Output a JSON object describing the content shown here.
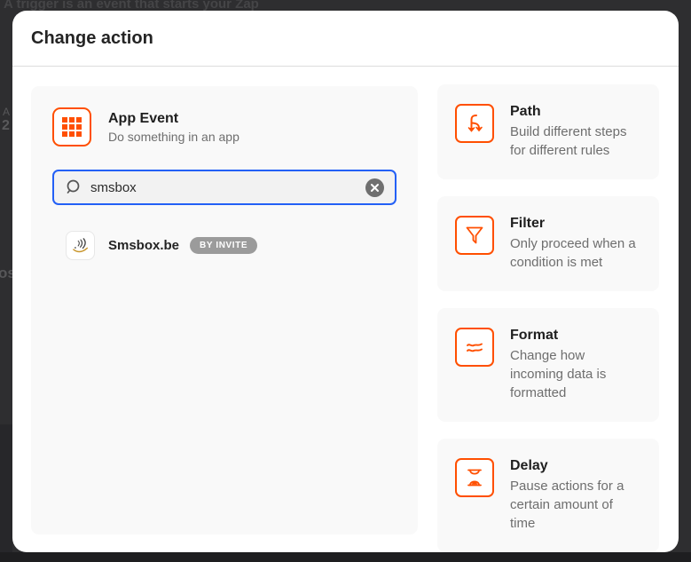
{
  "background": {
    "top_text": "A trigger is an event that starts your Zap",
    "left_fragment_a": "A",
    "left_fragment_2": "2",
    "left_fragment_ose": "ose"
  },
  "modal": {
    "title": "Change action",
    "left_panel": {
      "app_event": {
        "title": "App Event",
        "subtitle": "Do something in an app"
      },
      "search": {
        "value": "smsbox",
        "icon": "search-icon",
        "clear_icon": "clear-circle-icon"
      },
      "result": {
        "name": "Smsbox.be",
        "badge": "BY INVITE",
        "logo": "smsbox-logo"
      }
    },
    "cards": [
      {
        "icon": "path-icon",
        "title": "Path",
        "description": "Build different steps for different rules"
      },
      {
        "icon": "filter-icon",
        "title": "Filter",
        "description": "Only proceed when a condition is met"
      },
      {
        "icon": "format-icon",
        "title": "Format",
        "description": "Change how incoming data is formatted"
      },
      {
        "icon": "delay-icon",
        "title": "Delay",
        "description": "Pause actions for a certain amount of time"
      }
    ],
    "colors": {
      "accent_orange": "#FF4F00",
      "focus_blue": "#2360F6",
      "badge_gray": "#9B9B9B",
      "panel_gray": "#F9F9F9",
      "overlay_dark": "#2E2E30"
    }
  }
}
